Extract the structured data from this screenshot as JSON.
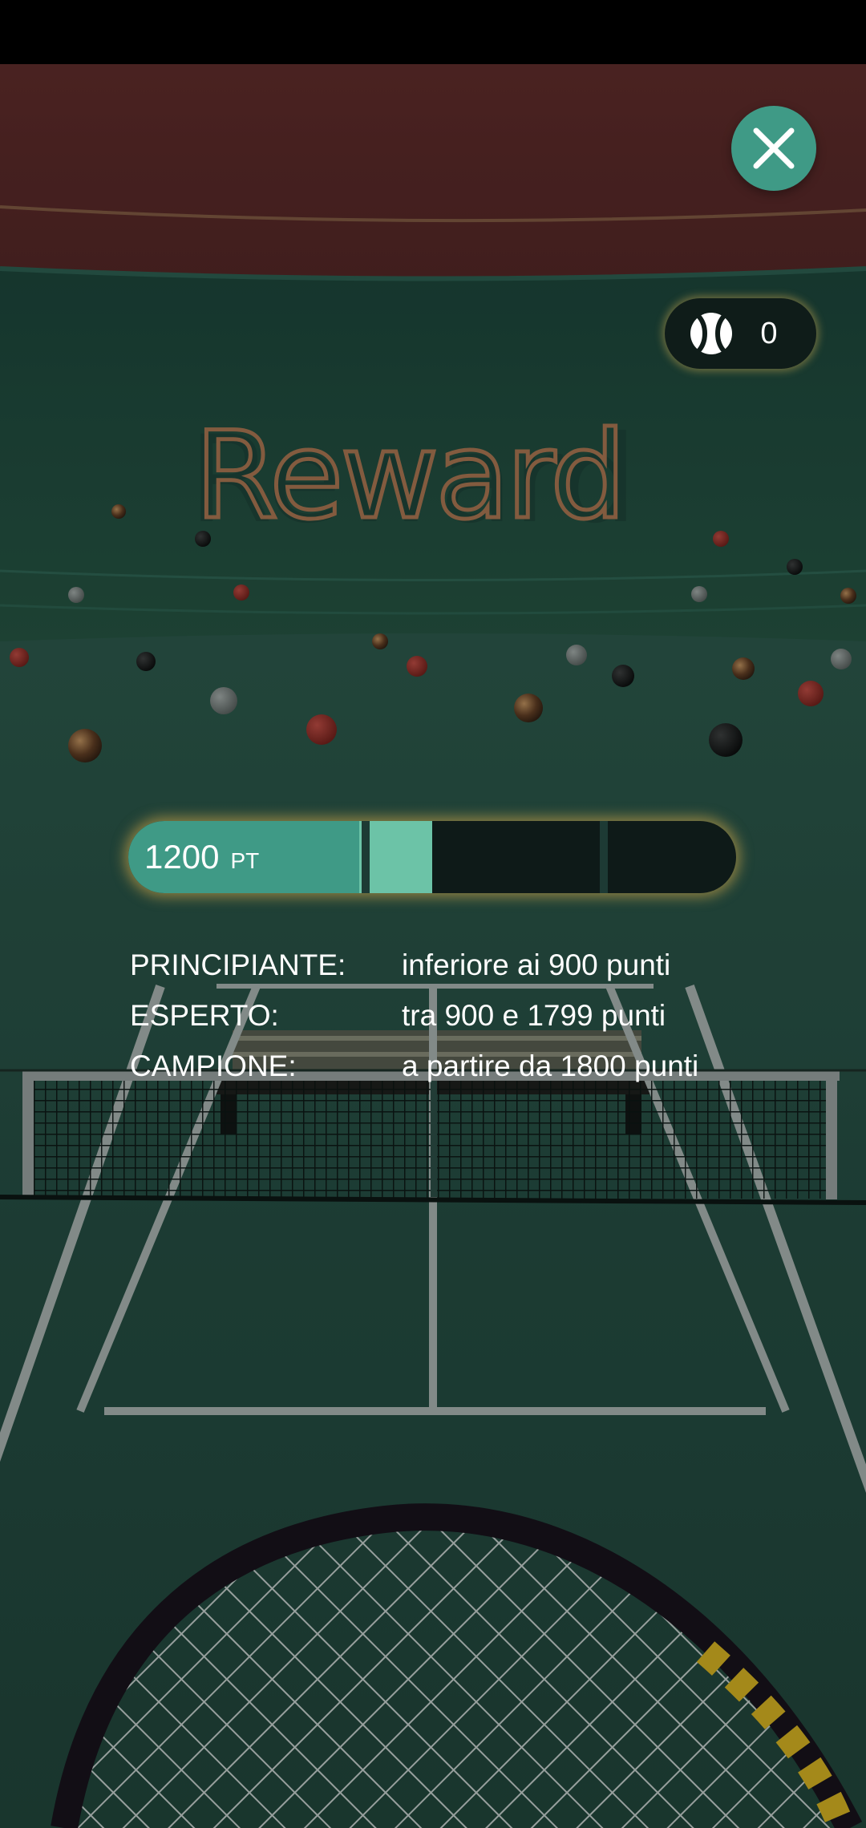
{
  "header": {
    "close_icon": "close-icon"
  },
  "scene": {
    "title": "Reward",
    "colors": {
      "wall_top": "#552827",
      "wall": "#1f4a40",
      "court": "#23493f",
      "accent": "#3f9a86"
    }
  },
  "ball_counter": {
    "icon": "tennis-ball-icon",
    "count": "0"
  },
  "progress": {
    "points": "1200",
    "unit": "PT",
    "fraction": 0.5
  },
  "levels": [
    {
      "name": "PRINCIPIANTE:",
      "description": "inferiore ai 900 punti"
    },
    {
      "name": "ESPERTO:",
      "description": "tra 900 e 1799 punti"
    },
    {
      "name": "CAMPIONE:",
      "description": "a partire da 1800 punti"
    }
  ]
}
